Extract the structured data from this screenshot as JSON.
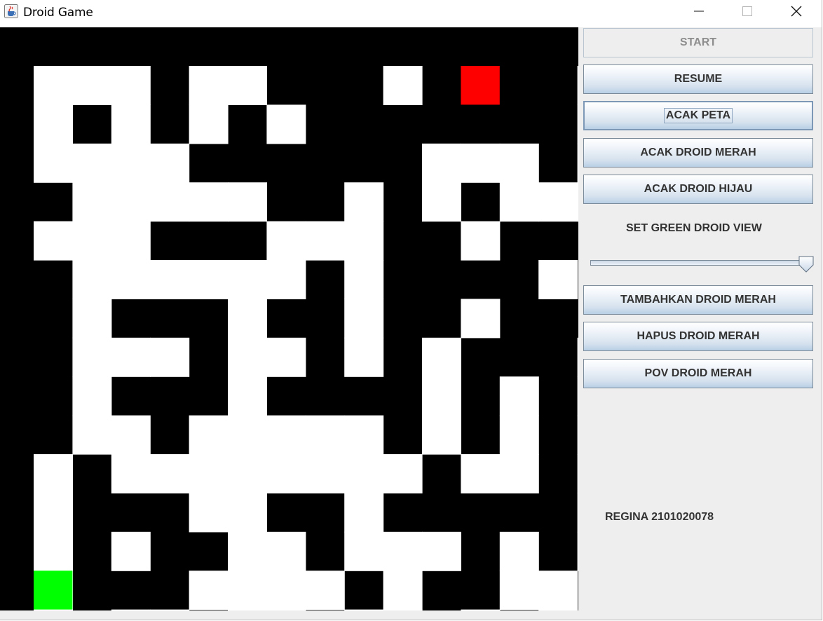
{
  "window": {
    "title": "Droid Game",
    "icon": "java-cup-icon",
    "controls": [
      "minimize-icon",
      "maximize-icon",
      "close-icon"
    ]
  },
  "maze": {
    "cols": 15,
    "rows": 15,
    "wall_color": "#000000",
    "path_color": "#ffffff",
    "grid": [
      "111011000100001",
      "101010100000001",
      "111100000011101",
      "011111001010111",
      "111000111001000",
      "011111101000010",
      "010001001001000",
      "011101101010001",
      "010001000010101",
      "011011111010101",
      "101111111101101",
      "100011001000001",
      "101001101110101",
      "100011110100110",
      "101101101101010"
    ],
    "red_droid": {
      "row": 0,
      "col": 11,
      "color": "#ff0000"
    },
    "green_droid": {
      "row": 13,
      "col": 0,
      "color": "#00ff00"
    }
  },
  "controls": {
    "start": "START",
    "resume": "RESUME",
    "acak_peta": "ACAK PETA",
    "acak_merah": "ACAK DROID MERAH",
    "acak_hijau": "ACAK DROID HIJAU",
    "view_label": "SET GREEN DROID VIEW",
    "view_value": 1.0,
    "tambah_merah": "TAMBAHKAN DROID MERAH",
    "hapus_merah": "HAPUS DROID MERAH",
    "pov_merah": "POV DROID MERAH"
  },
  "footer": {
    "author": "REGINA 2101020078"
  },
  "colors": {
    "panel_bg": "#eeeeee",
    "button_text": "#333333",
    "disabled_text": "#8e8e8e"
  }
}
